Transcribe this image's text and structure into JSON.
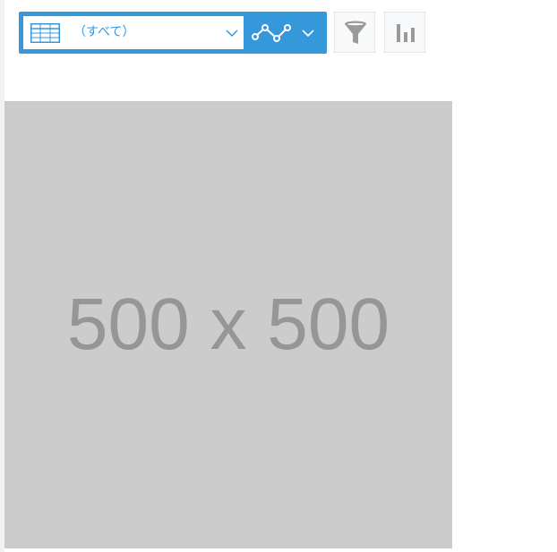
{
  "toolbar": {
    "view_select": {
      "label": "（すべて）",
      "icon": "table-icon"
    },
    "chart_type": {
      "icon": "line-chart-icon"
    },
    "filter_button": {
      "icon": "filter-icon"
    },
    "chart_button": {
      "icon": "bar-chart-icon"
    }
  },
  "content": {
    "placeholder_text": "500 x 500"
  },
  "colors": {
    "accent": "#3498db",
    "icon_gray": "#9a9a9a",
    "placeholder_bg": "#cccccc",
    "placeholder_text": "#969696"
  }
}
